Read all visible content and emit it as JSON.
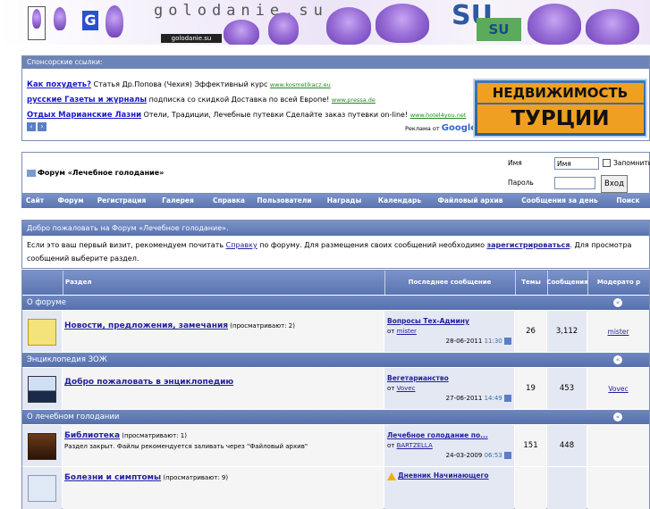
{
  "banner": {
    "title": "golodanie.su",
    "small": "golodanie.su",
    "logo_letter": "G",
    "su": "SU",
    "box_su": "SU"
  },
  "sponsor": {
    "header": "Спонсорские ссылки:",
    "ads": [
      {
        "title": "Как похудеть?",
        "text": " Статья Др.Попова (Чехия) Эффективный курс ",
        "url": "www.kosmetikacz.eu"
      },
      {
        "title": "русские Газеты и журналы",
        "text": " подписка со скидкой Доставка по всей Европе! ",
        "url": "www.pressa.de"
      },
      {
        "title": "Отдых Марианские Лазни",
        "text": " Отели, Традиции, Лечебные путевки Сделайте заказ путевки on-line! ",
        "url": "www.hotel4you.net"
      }
    ],
    "google_prefix": "Реклама от ",
    "google": "Google",
    "banner_line1": "НЕДВИЖИМОСТЬ",
    "banner_line2": "ТУРЦИИ"
  },
  "header": {
    "forum_title": "Форум «Лечебное голодание»",
    "login": {
      "user_label": "Имя",
      "user_value": "Имя",
      "remember": "Запомнить?",
      "pass_label": "Пароль",
      "button": "Вход"
    }
  },
  "nav": [
    "Сайт",
    "Форум",
    "Регистрация",
    "Галерея",
    "Справка",
    "Пользователи",
    "Награды",
    "Календарь",
    "Файловый архив",
    "Сообщения за день",
    "Поиск"
  ],
  "welcome": {
    "title": "Добро пожаловать на Форум «Лечебное голодание».",
    "t1": "Если это ваш первый визит, рекомендуем почитать ",
    "help_link": "Справку",
    "t2": " по форуму. Для размещения своих сообщений необходимо ",
    "reg_link": "зарегистрироваться",
    "t3": ". Для просмотра сообщений выберите раздел."
  },
  "table": {
    "headers": {
      "section": "Раздел",
      "last": "Последнее сообщение",
      "threads": "Темы",
      "posts": "Сообщения",
      "mods": "Модерато р"
    },
    "categories": [
      {
        "title": "О форуме",
        "forums": [
          {
            "name": "Новости, предложения, замечания",
            "viewing": " (просматривают: 2)",
            "desc": "",
            "last_title": "Вопросы Тех-Админу",
            "last_by": "от ",
            "last_user": "mister",
            "last_date": "28-06-2011",
            "last_time": "11:30",
            "threads": "26",
            "posts": "3,112",
            "mod": "mister"
          }
        ]
      },
      {
        "title": "Энциклопедия ЗОЖ",
        "forums": [
          {
            "name": "Добро пожаловать в энциклопедию",
            "viewing": "",
            "desc": "",
            "last_title": "Вегетарианство",
            "last_by": "от ",
            "last_user": "Vovec",
            "last_date": "27-06-2011",
            "last_time": "14:49",
            "threads": "19",
            "posts": "453",
            "mod": "Vovec"
          }
        ]
      },
      {
        "title": "О лечебном голодании",
        "forums": [
          {
            "name": "Библиотека",
            "viewing": " (просматривают: 1)",
            "desc": "Раздел закрыт. Файлы рекомендуется заливать через \"Файловый архив\"",
            "last_title": "Лечебное голодание по...",
            "last_by": "от ",
            "last_user": "BARTZELLA",
            "last_date": "24-03-2009",
            "last_time": "06:53",
            "threads": "151",
            "posts": "448",
            "mod": ""
          },
          {
            "name": "Болезни и симптомы",
            "viewing": " (просматривают: 9)",
            "desc": "",
            "last_title": "Дневник Начинающего",
            "last_by": "",
            "last_user": "",
            "last_date": "",
            "last_time": "",
            "threads": "",
            "posts": "",
            "mod": ""
          }
        ]
      }
    ]
  },
  "colors": {
    "header_blue": "#5a74b0",
    "link": "#22229c",
    "row_light": "#f5f5f5",
    "row_alt": "#e4e8f2"
  }
}
